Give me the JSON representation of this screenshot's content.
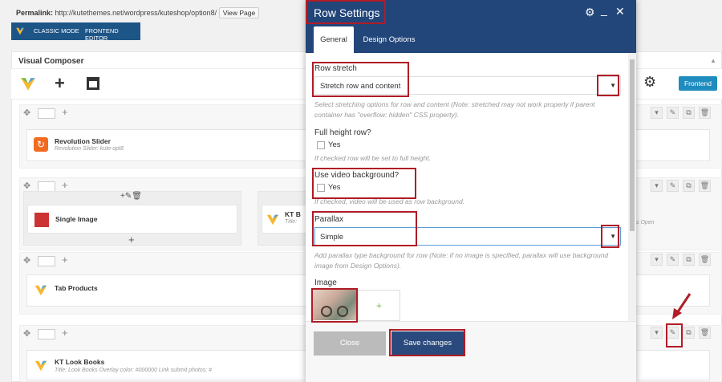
{
  "permalink": {
    "label": "Permalink:",
    "url": "http://kutethemes.net/wordpress/kuteshop/option8/",
    "view_button": "View Page"
  },
  "mode_bar": {
    "classic_label": "CLASSIC MODE",
    "frontend_label": "FRONTEND EDITOR"
  },
  "panel_title": "Visual Composer",
  "vc_toolbar": {
    "frontend_button": "Frontend"
  },
  "rows": [
    {
      "element_title": "Revolution Slider",
      "element_sub": "Revolution Slider: kute-opt8"
    },
    {
      "col1_title": "Single Image",
      "col2_title": "KT B",
      "col2_sub": "Title:",
      "col3_sub": "s Open"
    },
    {
      "element_title": "Tab Products"
    },
    {
      "element_title": "KT Look Books",
      "element_sub": "Title: Look Books  Overlay color: #000000  Link submit photos: #"
    }
  ],
  "dialog": {
    "title": "Row Settings",
    "tabs": [
      "General",
      "Design Options"
    ],
    "row_stretch": {
      "label": "Row stretch",
      "value": "Stretch row and content",
      "help": "Select stretching options for row and content (Note: stretched may not work properly if parent container has \"overflow: hidden\" CSS property)."
    },
    "full_height": {
      "label": "Full height row?",
      "option": "Yes",
      "help": "If checked row will be set to full height."
    },
    "video_bg": {
      "label": "Use video background?",
      "option": "Yes",
      "help": "If checked, video will be used as row background."
    },
    "parallax": {
      "label": "Parallax",
      "value": "Simple",
      "help": "Add parallax type background for row (Note: if no image is specified, parallax will use background image from Design Options)."
    },
    "image": {
      "label": "Image",
      "add": "+"
    },
    "close_button": "Close",
    "save_button": "Save changes"
  },
  "colors": {
    "header_blue": "#23467a",
    "accent_red": "#b01c26",
    "save_blue": "#2a4a7d",
    "vc_blue": "#1e8cbe"
  }
}
